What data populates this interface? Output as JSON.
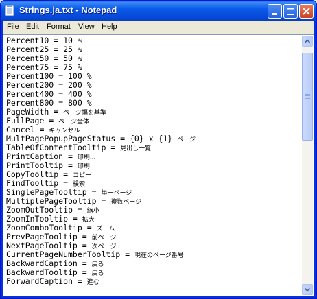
{
  "window": {
    "title": "Strings.ja.txt - Notepad"
  },
  "menu": {
    "file": "File",
    "edit": "Edit",
    "format": "Format",
    "view": "View",
    "help": "Help"
  },
  "lines": [
    {
      "key": "Percent10 = 10 %",
      "jp": ""
    },
    {
      "key": "Percent25 = 25 %",
      "jp": ""
    },
    {
      "key": "Percent50 = 50 %",
      "jp": ""
    },
    {
      "key": "Percent75 = 75 %",
      "jp": ""
    },
    {
      "key": "Percent100 = 100 %",
      "jp": ""
    },
    {
      "key": "Percent200 = 200 %",
      "jp": ""
    },
    {
      "key": "Percent400 = 400 %",
      "jp": ""
    },
    {
      "key": "Percent800 = 800 %",
      "jp": ""
    },
    {
      "key": "PageWidth = ",
      "jp": "ページ幅を基準"
    },
    {
      "key": "FullPage = ",
      "jp": "ページ全体"
    },
    {
      "key": "Cancel = ",
      "jp": "キャンセル"
    },
    {
      "key": "MultPagePopupPageStatus = {0} x {1} ",
      "jp": "ページ"
    },
    {
      "key": "TableOfContentTooltip = ",
      "jp": "見出し一覧"
    },
    {
      "key": "PrintCaption = ",
      "jp": "印刷..."
    },
    {
      "key": "PrintTooltip = ",
      "jp": "印刷"
    },
    {
      "key": "CopyTooltip = ",
      "jp": "コピー"
    },
    {
      "key": "FindTooltip = ",
      "jp": "検索"
    },
    {
      "key": "SinglePageTooltip = ",
      "jp": "単一ページ"
    },
    {
      "key": "MultiplePageTooltip = ",
      "jp": "複数ページ"
    },
    {
      "key": "ZoomOutTooltip = ",
      "jp": "縮小"
    },
    {
      "key": "ZoomInTooltip = ",
      "jp": "拡大"
    },
    {
      "key": "ZoomComboTooltip = ",
      "jp": "ズーム"
    },
    {
      "key": "PrevPageTooltip = ",
      "jp": "前ページ"
    },
    {
      "key": "NextPageTooltip = ",
      "jp": "次ページ"
    },
    {
      "key": "CurrentPageNumberTooltip = ",
      "jp": "現在のページ番号"
    },
    {
      "key": "BackwardCaption = ",
      "jp": "戻る"
    },
    {
      "key": "BackwardTooltip = ",
      "jp": "戻る"
    },
    {
      "key": "ForwardCaption = ",
      "jp": "進む"
    }
  ]
}
